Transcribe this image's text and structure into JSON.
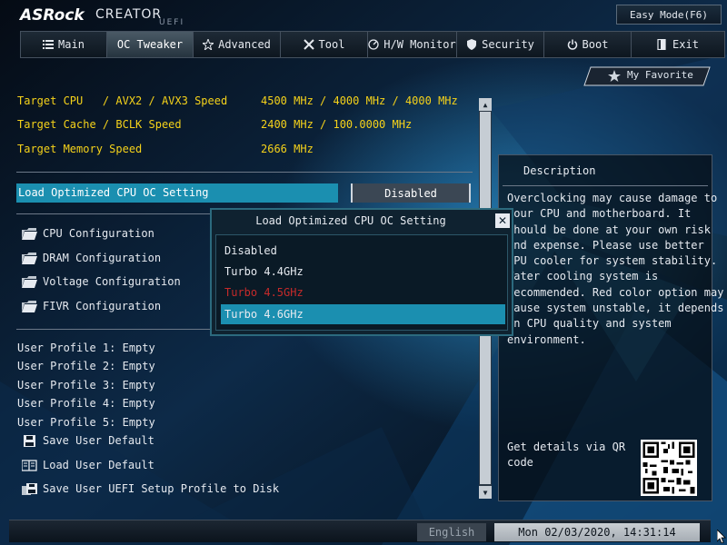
{
  "header": {
    "brand": "ASRock",
    "product": "CREATOR",
    "firmware": "UEFI",
    "easy_mode": "Easy Mode(F6)"
  },
  "tabs": [
    {
      "label": "Main",
      "icon": "list-icon",
      "active": false
    },
    {
      "label": "OC Tweaker",
      "icon": "",
      "active": true
    },
    {
      "label": "Advanced",
      "icon": "star-icon",
      "active": false
    },
    {
      "label": "Tool",
      "icon": "tools-icon",
      "active": false
    },
    {
      "label": "H/W Monitor",
      "icon": "gauge-icon",
      "active": false
    },
    {
      "label": "Security",
      "icon": "shield-icon",
      "active": false
    },
    {
      "label": "Boot",
      "icon": "power-icon",
      "active": false
    },
    {
      "label": "Exit",
      "icon": "exit-icon",
      "active": false
    }
  ],
  "favorite": {
    "label": "My Favorite",
    "icon": "star-icon"
  },
  "targets": [
    {
      "label": "Target CPU   / AVX2 / AVX3 Speed",
      "value": "4500 MHz / 4000 MHz / 4000 MHz"
    },
    {
      "label": "Target Cache / BCLK Speed",
      "value": "2400 MHz / 100.0000 MHz"
    },
    {
      "label": "Target Memory Speed",
      "value": "2666 MHz"
    }
  ],
  "selected_setting": {
    "label": "Load Optimized CPU OC Setting",
    "value": "Disabled"
  },
  "menu": [
    {
      "label": "CPU Configuration",
      "icon": "folder-icon"
    },
    {
      "label": "DRAM Configuration",
      "icon": "folder-icon"
    },
    {
      "label": "Voltage Configuration",
      "icon": "folder-icon"
    },
    {
      "label": "FIVR Configuration",
      "icon": "folder-icon"
    }
  ],
  "profiles": [
    "User Profile 1: Empty",
    "User Profile 2: Empty",
    "User Profile 3: Empty",
    "User Profile 4: Empty",
    "User Profile 5: Empty"
  ],
  "actions": [
    {
      "label": "Save User Default",
      "icon": "save-icon"
    },
    {
      "label": "Load User Default",
      "icon": "load-icon"
    },
    {
      "label": "Save User UEFI Setup Profile to Disk",
      "icon": "save-disk-icon"
    }
  ],
  "description": {
    "title": "Description",
    "text": "Overclocking may cause damage to\nyour CPU and motherboard. It\nshould be done at your own risk\nand expense. Please use better\nCPU cooler for system stability.\nWater cooling system is\nrecommended. Red color option may\ncause system unstable, it depends\non CPU quality and system\nenvironment.",
    "qr_label": "Get details via QR\ncode"
  },
  "popup": {
    "title": "Load Optimized CPU OC Setting",
    "options": [
      {
        "label": "Disabled",
        "warning": false,
        "selected": false
      },
      {
        "label": "Turbo 4.4GHz",
        "warning": false,
        "selected": false
      },
      {
        "label": "Turbo 4.5GHz",
        "warning": true,
        "selected": false
      },
      {
        "label": "Turbo 4.6GHz",
        "warning": false,
        "selected": true
      }
    ]
  },
  "footer": {
    "language": "English",
    "datetime": "Mon 02/03/2020, 14:31:14"
  },
  "colors": {
    "accent": "#1b8fb0",
    "target_text": "#f5d21a",
    "warning_option": "#c62a2a"
  }
}
